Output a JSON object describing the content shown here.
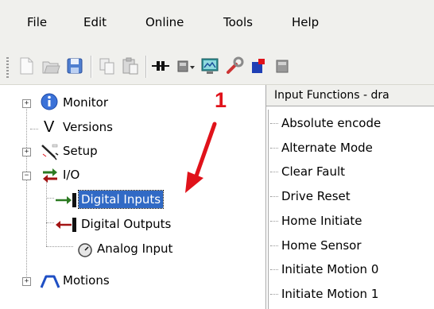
{
  "menu": [
    "File",
    "Edit",
    "Online",
    "Tools",
    "Help"
  ],
  "toolbar": {
    "icons": [
      "new-icon",
      "open-icon",
      "save-icon",
      "copy-icon",
      "paste-icon",
      "connect-icon",
      "drive-icon",
      "monitor-icon",
      "tools-icon",
      "upload-icon",
      "module-icon"
    ]
  },
  "tree": {
    "monitor": "Monitor",
    "versions": "Versions",
    "setup": "Setup",
    "io": "I/O",
    "digital_inputs": "Digital Inputs",
    "digital_outputs": "Digital Outputs",
    "analog_input": "Analog Input",
    "motions": "Motions"
  },
  "annotation": {
    "number": "1",
    "color": "#e0121a"
  },
  "panel": {
    "header": "Input Functions - dra",
    "items": [
      "Absolute encode",
      "Alternate Mode",
      "Clear Fault",
      "Drive Reset",
      "Home Initiate",
      "Home Sensor",
      "Initiate Motion 0",
      "Initiate Motion 1"
    ]
  },
  "colors": {
    "selection": "#316ac5",
    "chrome": "#f0f0ed"
  }
}
